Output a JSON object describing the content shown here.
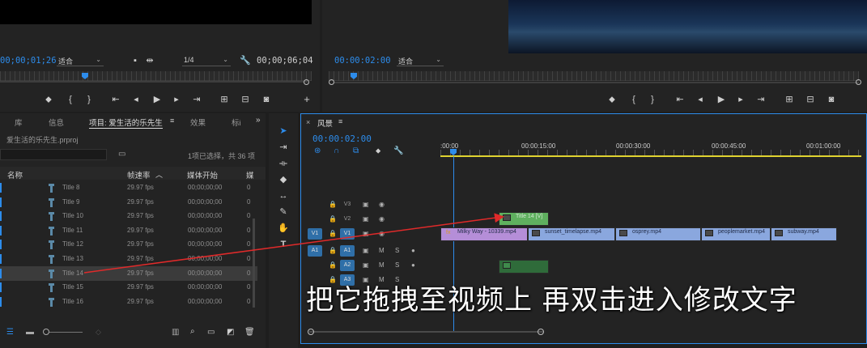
{
  "source_monitor": {
    "timecode_in": "00;00;01;26",
    "zoom": "适合",
    "resolution": "1/4",
    "timecode_duration": "00;00;06;04"
  },
  "program_monitor": {
    "timecode": "00:00:02:00",
    "zoom": "适合"
  },
  "project_panel": {
    "tabs": [
      "库",
      "信息",
      "项目: 爱生活的乐先生",
      "效果",
      "标i"
    ],
    "file_name": "爱生活的乐先生.prproj",
    "selection_status": "1项已选择，共 36 项",
    "columns": {
      "name": "名称",
      "frame_rate": "帧速率",
      "media_start": "媒体开始",
      "media_end": "媒"
    },
    "rows": [
      {
        "name": "Title 8",
        "fps": "29.97 fps",
        "start": "00;00;00;00",
        "end": "0"
      },
      {
        "name": "Title 9",
        "fps": "29.97 fps",
        "start": "00;00;00;00",
        "end": "0"
      },
      {
        "name": "Title 10",
        "fps": "29.97 fps",
        "start": "00;00;00;00",
        "end": "0"
      },
      {
        "name": "Title 11",
        "fps": "29.97 fps",
        "start": "00;00;00;00",
        "end": "0"
      },
      {
        "name": "Title 12",
        "fps": "29.97 fps",
        "start": "00;00;00;00",
        "end": "0"
      },
      {
        "name": "Title 13",
        "fps": "29.97 fps",
        "start": "00;00;00;00",
        "end": "0"
      },
      {
        "name": "Title 14",
        "fps": "29.97 fps",
        "start": "00;00;00;00",
        "end": "0"
      },
      {
        "name": "Title 15",
        "fps": "29.97 fps",
        "start": "00;00;00;00",
        "end": "0"
      },
      {
        "name": "Title 16",
        "fps": "29.97 fps",
        "start": "00;00;00;00",
        "end": "0"
      }
    ],
    "selected_row": "Title 14"
  },
  "timeline": {
    "sequence_name": "风景",
    "timecode": "00:00:02:00",
    "ruler": [
      ":00:00",
      "00:00:15:00",
      "00:00:30:00",
      "00:00:45:00",
      "00:01:00:00"
    ],
    "tracks": {
      "v3": "V3",
      "v2": "V2",
      "v1": "V1",
      "a1": "A1",
      "a2": "A2",
      "a3": "A3",
      "src_v1": "V1",
      "src_a1": "A1",
      "m": "M",
      "s": "S"
    },
    "clips": {
      "title": "Title 14 [V]",
      "milky": "Milky Way - 10339.mp4",
      "sunset": "sunset_timelapse.mp4",
      "osprey": "osprey.mp4",
      "people": "peoplemarket.mp4",
      "subway": "subway.mp4"
    },
    "fx_badge": "fx"
  },
  "subtitle": "把它拖拽至视频上 再双击进入修改文字",
  "colors": {
    "accent": "#2d8ceb",
    "selection": "#3b3b3b",
    "video_clip": "#8aa7de",
    "title_clip": "#5fb05f",
    "arrow": "#e02a2a"
  }
}
